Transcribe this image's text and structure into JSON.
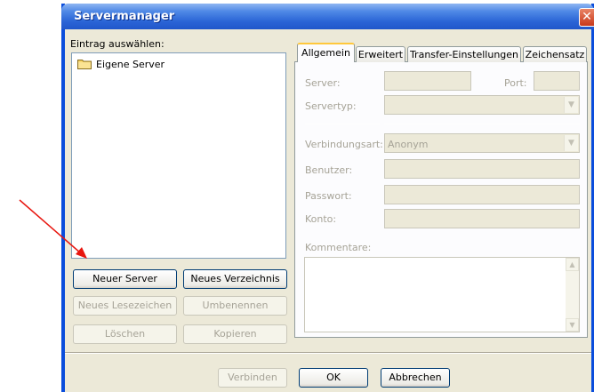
{
  "window": {
    "title": "Servermanager",
    "close_glyph": "✕"
  },
  "left": {
    "select_label": "Eintrag auswählen:",
    "tree": [
      {
        "label": "Eigene Server",
        "icon": "folder-icon"
      }
    ],
    "buttons": {
      "new_server": "Neuer Server",
      "new_folder": "Neues Verzeichnis",
      "new_bookmark": "Neues Lesezeichen",
      "rename": "Umbenennen",
      "delete": "Löschen",
      "copy": "Kopieren"
    }
  },
  "tabs": [
    "Allgemein",
    "Erweitert",
    "Transfer-Einstellungen",
    "Zeichensatz"
  ],
  "general": {
    "server_label": "Server:",
    "server_value": "",
    "port_label": "Port:",
    "port_value": "",
    "servertype_label": "Servertyp:",
    "servertype_value": "",
    "connection_label": "Verbindungsart:",
    "connection_value": "Anonym",
    "user_label": "Benutzer:",
    "user_value": "",
    "password_label": "Passwort:",
    "password_value": "",
    "account_label": "Konto:",
    "account_value": "",
    "comments_label": "Kommentare:",
    "comments_value": ""
  },
  "footer": {
    "connect": "Verbinden",
    "ok": "OK",
    "cancel": "Abbrechen"
  },
  "colors": {
    "title_blue": "#0a4ddc",
    "annotation_arrow": "#e8160f",
    "tab_highlight": "#ffc83c"
  }
}
